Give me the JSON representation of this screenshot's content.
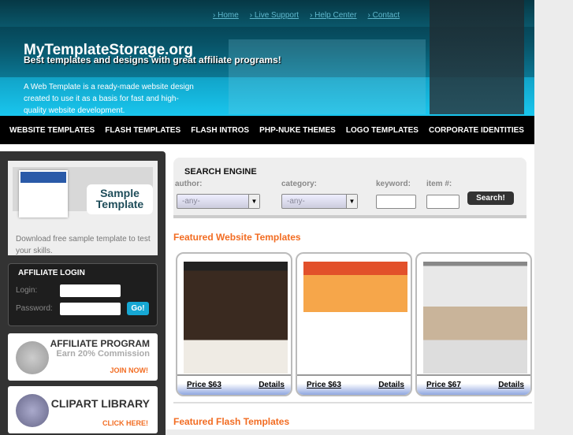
{
  "header": {
    "top_links": [
      "Home",
      "Live Support",
      "Help Center",
      "Contact"
    ],
    "site_title": "MyTemplateStorage.org",
    "tagline": "Best templates and designs with great affiliate programs!",
    "intro": "A Web Template is a ready-made website design created to use it as a basis for fast and high-quality website development."
  },
  "nav": [
    "WEBSITE TEMPLATES",
    "FLASH TEMPLATES",
    "FLASH INTROS",
    "PHP-NUKE THEMES",
    "LOGO TEMPLATES",
    "CORPORATE IDENTITIES"
  ],
  "sidebar": {
    "sample_label": "Sample Template",
    "sample_desc": "Download free sample template to test your skills.",
    "login_title": "AFFILIATE LOGIN",
    "login_label": "Login:",
    "password_label": "Password:",
    "go": "Go!",
    "affiliate": {
      "title": "AFFILIATE PROGRAM",
      "sub": "Earn 20% Commission",
      "cta": "JOIN NOW!"
    },
    "clipart": {
      "title": "CLIPART LIBRARY",
      "cta": "CLICK HERE!"
    }
  },
  "search": {
    "title": "SEARCH ENGINE",
    "author_label": "author:",
    "author_value": "-any-",
    "category_label": "category:",
    "category_value": "-any-",
    "keyword_label": "keyword:",
    "item_label": "item #:",
    "button": "Search!"
  },
  "featured_title": "Featured Website Templates",
  "cards": [
    {
      "price": "Price $63",
      "details": "Details"
    },
    {
      "price": "Price $63",
      "details": "Details"
    },
    {
      "price": "Price $67",
      "details": "Details"
    }
  ],
  "flash_title": "Featured Flash Templates",
  "colors": {
    "accent": "#f26c22",
    "go": "#16a7d3"
  }
}
